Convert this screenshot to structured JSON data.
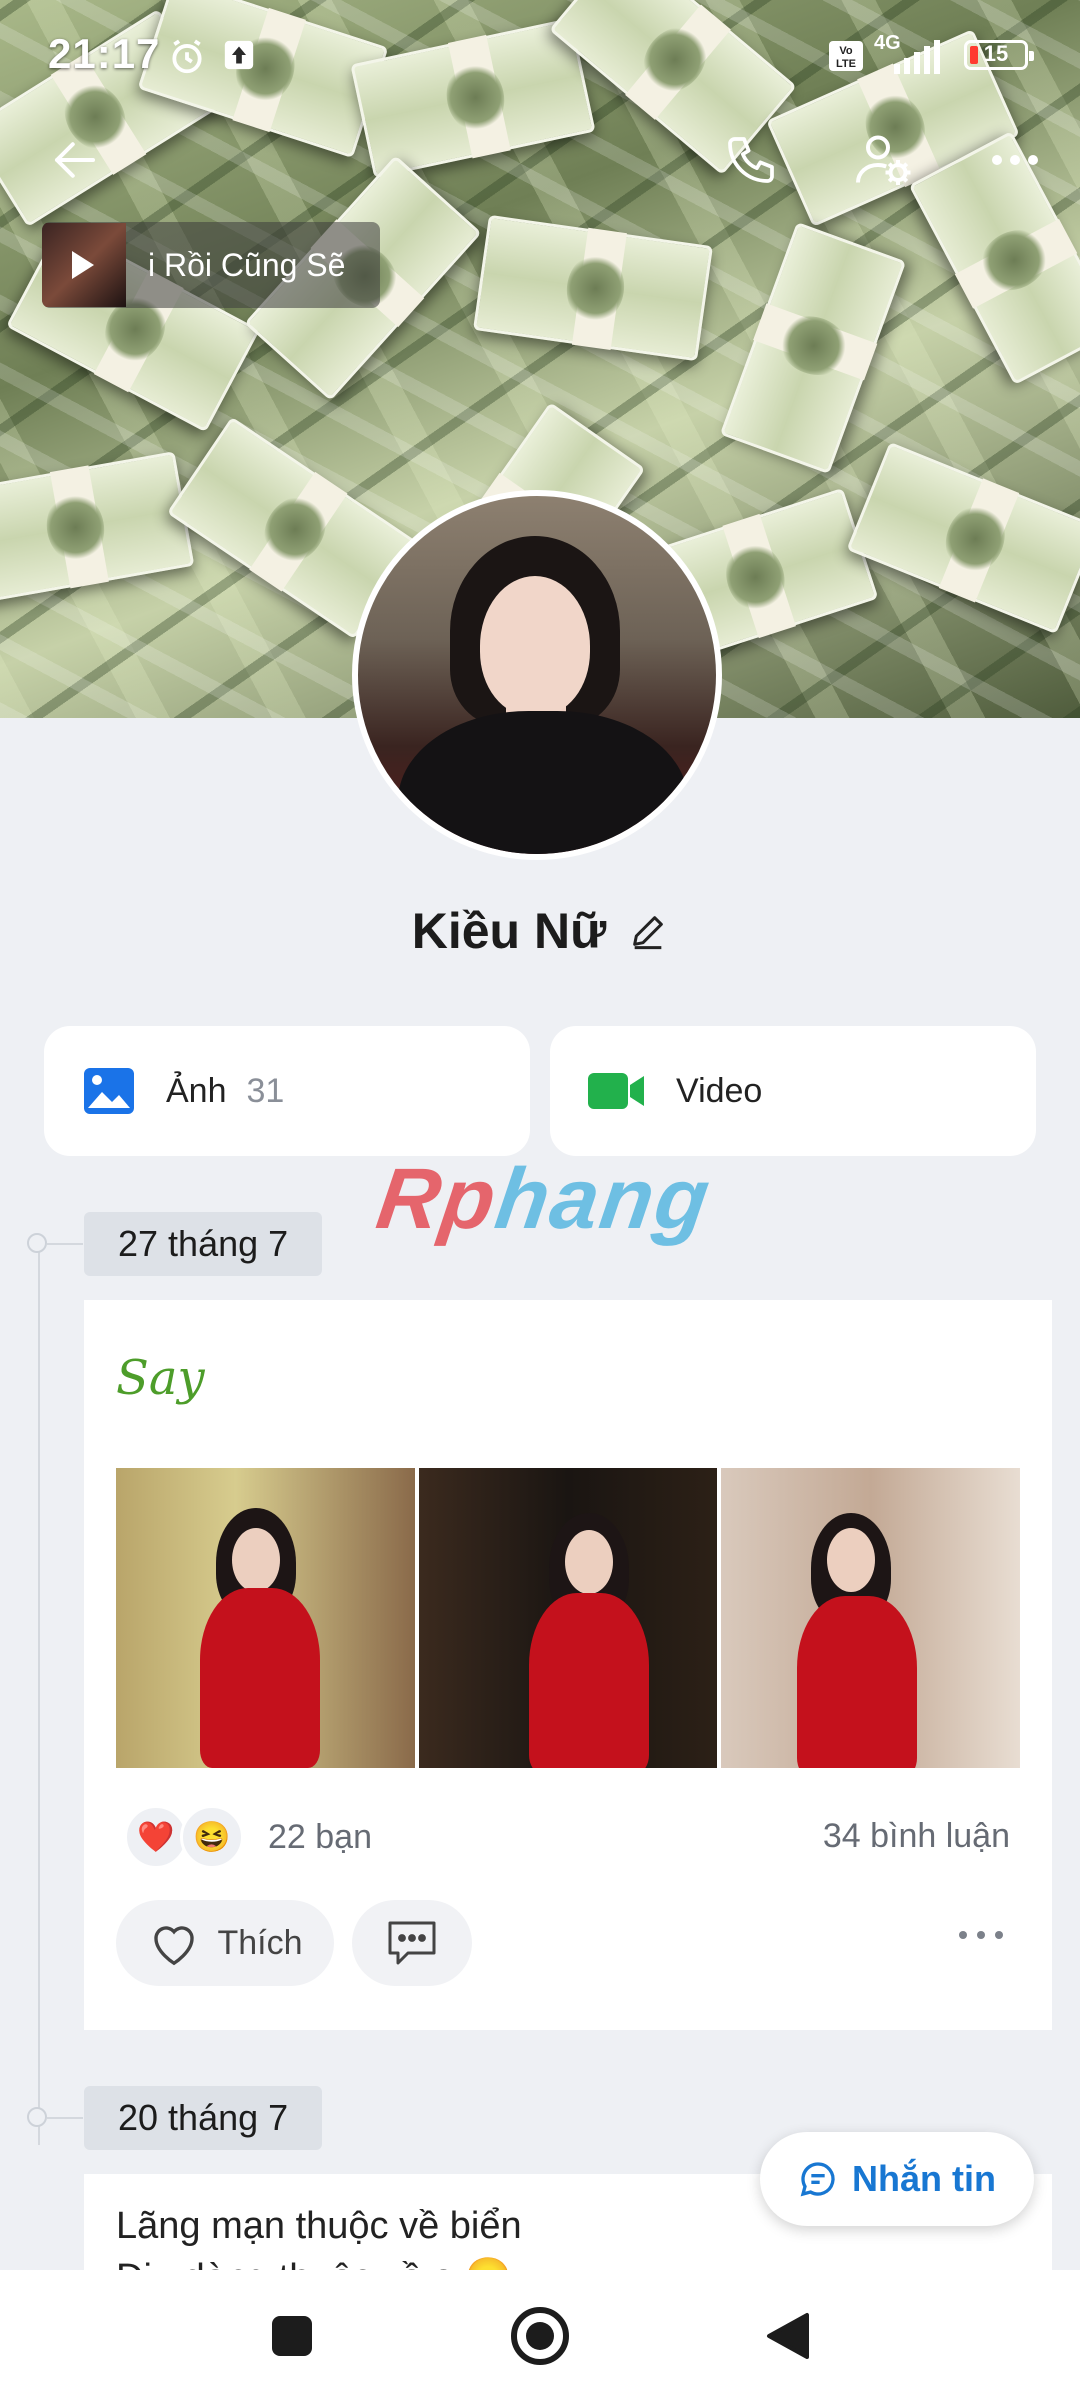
{
  "status_bar": {
    "time": "21:17",
    "network": "4G",
    "volte": "Vo LTE",
    "battery": "15",
    "icons": [
      "alarm-icon",
      "upload-icon",
      "volte-icon",
      "signal-icon",
      "battery-icon"
    ]
  },
  "header": {
    "back_icon": "arrow-left-icon",
    "call_icon": "phone-icon",
    "settings_icon": "user-settings-icon",
    "more_icon": "more-horizontal-icon"
  },
  "music": {
    "title": "i Rồi Cũng Sẽ"
  },
  "profile": {
    "name": "Kiều Nữ",
    "edit_icon": "pencil-icon"
  },
  "media": {
    "photos_label": "Ảnh",
    "photos_count": "31",
    "video_label": "Video"
  },
  "watermark": {
    "part1": "Rp",
    "part2": "hang"
  },
  "timeline": [
    {
      "date": "27 tháng 7",
      "caption": "Say",
      "reactions": [
        "❤️",
        "😆"
      ],
      "reaction_count": "22 bạn",
      "comment_count": "34 bình luận",
      "like_label": "Thích"
    },
    {
      "date": "20 tháng 7",
      "text_line1": "Lãng mạn thuộc về biển",
      "text_line2": "Dịu dàng thuộc về e 😊"
    }
  ],
  "message_button": {
    "label": "Nhắn tin"
  },
  "colors": {
    "accent": "#1877d2",
    "say_green": "#4d9d2a",
    "background": "#eef0f4"
  }
}
